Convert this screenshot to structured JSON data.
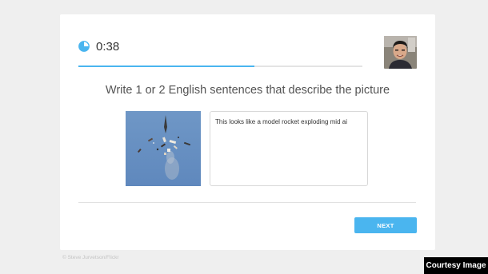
{
  "timer": {
    "icon": "timer-pie-icon",
    "text": "0:38"
  },
  "progress": {
    "fraction": 0.62,
    "color": "#4ab5ef"
  },
  "avatar": {
    "icon": "webcam-user-avatar"
  },
  "prompt": {
    "text": "Write 1 or 2 English sentences that describe the picture"
  },
  "photo": {
    "icon": "model-rocket-exploding-photo"
  },
  "answer": {
    "value": "This looks like a model rocket exploding mid ai"
  },
  "actions": {
    "next_label": "NEXT"
  },
  "footer": {
    "credit": "© Steve Jurvetson/Flickr"
  },
  "overlay": {
    "courtesy": "Courtesy Image"
  },
  "colors": {
    "accent": "#4ab5ef",
    "background": "#efefef",
    "card": "#ffffff"
  }
}
